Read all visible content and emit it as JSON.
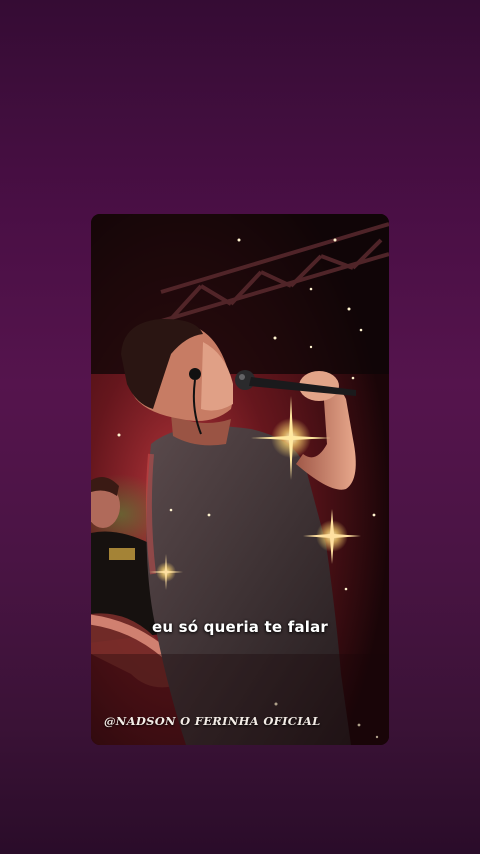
{
  "video": {
    "lyric_caption": "eu só queria te falar",
    "watermark": "@NADSON O FERINHA OFICIAL"
  },
  "colors": {
    "background_top": "#350c34",
    "background_mid": "#55144d",
    "background_bottom": "#2a0c29",
    "stage_light": "#e0404a",
    "sparkle": "#ffd870"
  }
}
